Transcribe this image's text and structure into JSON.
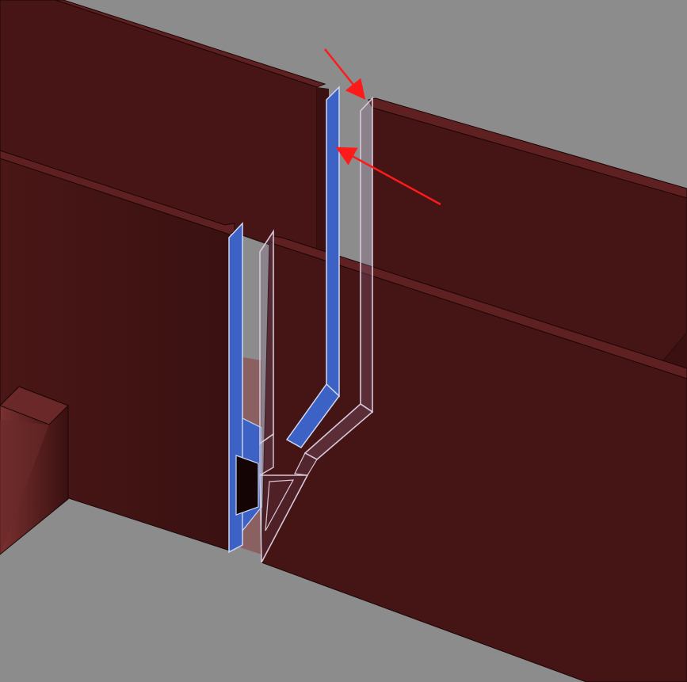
{
  "viewport": {
    "kind": "3d-model-section-view",
    "background_color": "#8c8c8c"
  },
  "colors": {
    "wall_face": "#471515",
    "wall_face_dark": "#3d1212",
    "wall_top": "#5e2020",
    "wall_edge": "#1a0606",
    "floor": "#8e8e8e",
    "selected_profile": "#3b62c4",
    "selected_profile_light": "#6f8fdc",
    "ghost_profile_stroke": "#d6c8d8",
    "ghost_profile_fill": "#8a6a8a",
    "annotation_arrow": "#ff1a1a",
    "block_front": "#6a2828",
    "block_side": "#4a1818"
  },
  "annotations": [
    {
      "name": "arrow-upper",
      "target": "ghost-profile-right-leg-tip"
    },
    {
      "name": "arrow-lower",
      "target": "selected-profile-right-leg"
    }
  ],
  "objects": [
    {
      "name": "back-wall-right",
      "type": "wall"
    },
    {
      "name": "back-wall-left",
      "type": "wall"
    },
    {
      "name": "front-wall-left",
      "type": "wall"
    },
    {
      "name": "front-wall-right",
      "type": "wall"
    },
    {
      "name": "floor-block",
      "type": "block"
    },
    {
      "name": "selected-u-profile",
      "type": "profile",
      "state": "selected"
    },
    {
      "name": "ghost-u-profile",
      "type": "profile",
      "state": "preview"
    }
  ]
}
